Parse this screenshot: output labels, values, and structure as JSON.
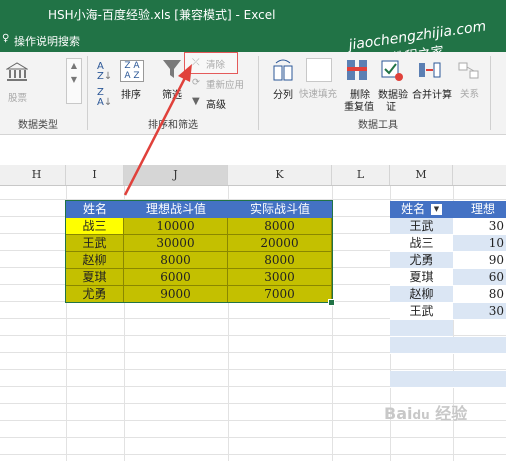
{
  "window": {
    "title": "HSH小海-百度经验.xls [兼容模式] - Excel",
    "tell_me": "操作说明搜索"
  },
  "watermark": {
    "line1": "jiaochengzhijia.com",
    "line2": "教程之家"
  },
  "ribbon": {
    "datatype": {
      "option": "股票",
      "group": "数据类型"
    },
    "sortfilter": {
      "sort": "排序",
      "filter": "筛选",
      "clear": "清除",
      "reapply": "重新应用",
      "advanced": "高级",
      "group": "排序和筛选"
    },
    "datatools": {
      "text_to_columns": "分列",
      "flash_fill": "快速填充",
      "remove_dup_1": "删除",
      "remove_dup_2": "重复值",
      "validation_1": "数据验",
      "validation_2": "证",
      "consolidate": "合并计算",
      "relationships": "关系",
      "group": "数据工具"
    }
  },
  "columns": [
    "H",
    "I",
    "J",
    "K",
    "L",
    "M"
  ],
  "table1": {
    "headers": [
      "姓名",
      "理想战斗值",
      "实际战斗值"
    ],
    "rows": [
      [
        "战三",
        "10000",
        "8000"
      ],
      [
        "王武",
        "30000",
        "20000"
      ],
      [
        "赵柳",
        "8000",
        "8000"
      ],
      [
        "夏琪",
        "6000",
        "3000"
      ],
      [
        "尤勇",
        "9000",
        "7000"
      ]
    ]
  },
  "table2": {
    "headers": [
      "姓名",
      "理想"
    ],
    "rows": [
      [
        "王武",
        "30"
      ],
      [
        "战三",
        "10"
      ],
      [
        "尤勇",
        "90"
      ],
      [
        "夏琪",
        "60"
      ],
      [
        "赵柳",
        "80"
      ],
      [
        "王武",
        "30"
      ]
    ]
  },
  "colors": {
    "excel_green": "#217346",
    "header_blue": "#4472c4",
    "cell_olive": "#c4c000",
    "selected_yellow": "#ffff00",
    "arrow_red": "#e0413b"
  }
}
